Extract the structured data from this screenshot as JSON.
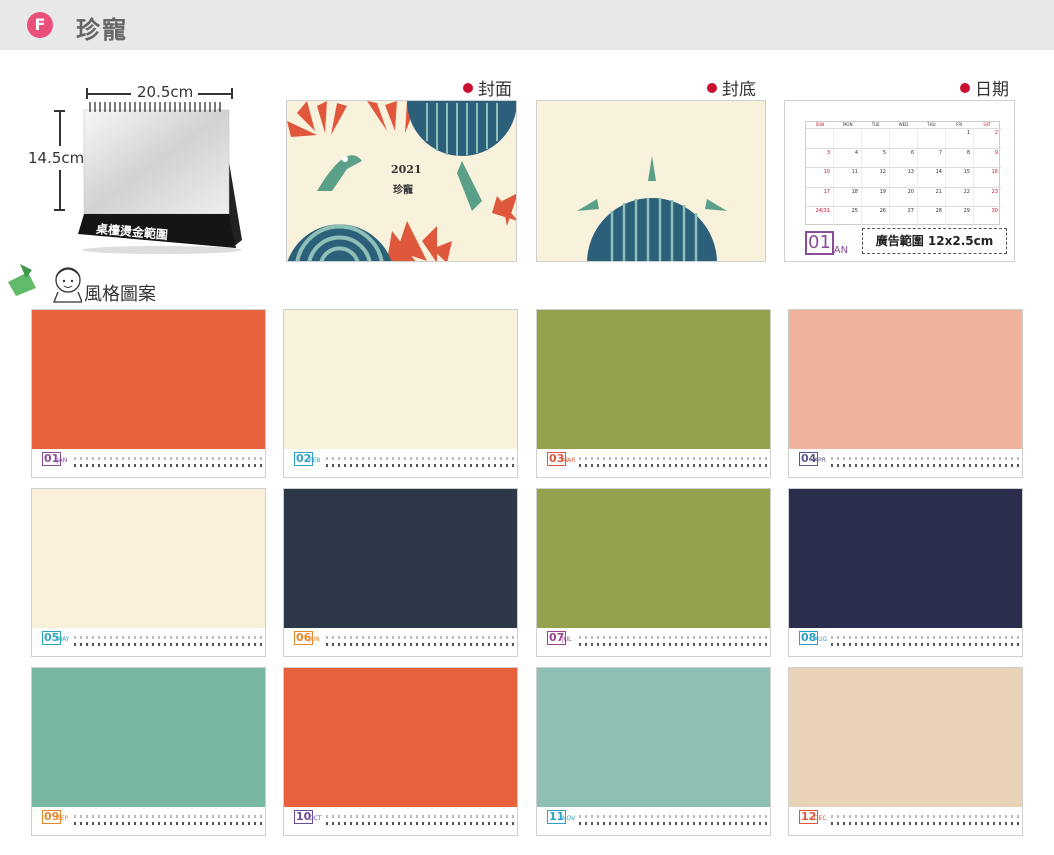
{
  "header": {
    "badge": "F",
    "title": "珍寵"
  },
  "product": {
    "width_label": "20.5cm",
    "height_label": "14.5cm",
    "foil_label": "桌檯燙金範圍"
  },
  "captions": {
    "cover": "封面",
    "back": "封底",
    "date": "日期"
  },
  "cover": {
    "year": "2021",
    "name": "珍寵"
  },
  "calendar": {
    "weekdays": [
      "SUN",
      "MON",
      "TUE",
      "WED",
      "THU",
      "FRI",
      "SAT"
    ],
    "weeks": [
      [
        "",
        "",
        "",
        "",
        "",
        "1",
        "2"
      ],
      [
        "3",
        "4",
        "5",
        "6",
        "7",
        "8",
        "9"
      ],
      [
        "10",
        "11",
        "12",
        "13",
        "14",
        "15",
        "16"
      ],
      [
        "17",
        "18",
        "19",
        "20",
        "21",
        "22",
        "23"
      ],
      [
        "24|31",
        "25",
        "26",
        "27",
        "28",
        "29",
        "30"
      ]
    ],
    "month_num": "01",
    "month_name": "JAN",
    "ad_label": "廣告範圍 12x2.5cm"
  },
  "style_label": "風格圖案",
  "months": [
    {
      "num": "01",
      "name": "JAN",
      "bg": "#e8623c",
      "color": "#8a4b9a"
    },
    {
      "num": "02",
      "name": "FEB",
      "bg": "#f8f1dc",
      "color": "#2f9fc6"
    },
    {
      "num": "03",
      "name": "MAR",
      "bg": "#95a04a",
      "color": "#e0583c"
    },
    {
      "num": "04",
      "name": "APR",
      "bg": "#efb39b",
      "color": "#5a5a8a"
    },
    {
      "num": "05",
      "name": "MAY",
      "bg": "#f8f0d8",
      "color": "#2fa7c0"
    },
    {
      "num": "06",
      "name": "JUN",
      "bg": "#2c3848",
      "color": "#e8862c"
    },
    {
      "num": "07",
      "name": "JUL",
      "bg": "#96a14e",
      "color": "#a04090"
    },
    {
      "num": "08",
      "name": "AUG",
      "bg": "#2a2e4c",
      "color": "#2f9fc6"
    },
    {
      "num": "09",
      "name": "SEP",
      "bg": "#78b7a0",
      "color": "#e8862c"
    },
    {
      "num": "10",
      "name": "OCT",
      "bg": "#e7613c",
      "color": "#6a4a9a"
    },
    {
      "num": "11",
      "name": "NOV",
      "bg": "#8ec0b4",
      "color": "#2f9fc6"
    },
    {
      "num": "12",
      "name": "DEC",
      "bg": "#e8d3b7",
      "color": "#e0583c"
    }
  ]
}
